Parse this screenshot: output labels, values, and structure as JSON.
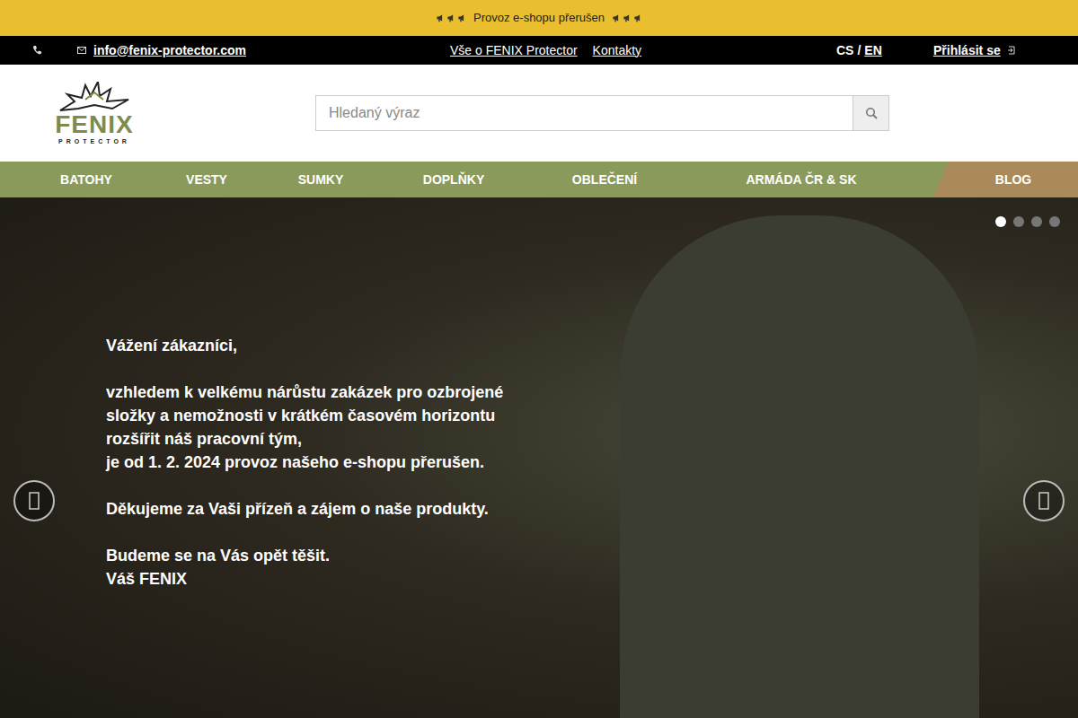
{
  "banner": {
    "text": "Provoz e-shopu přerušen"
  },
  "topbar": {
    "email": "info@fenix-protector.com",
    "links": [
      "Vše o FENIX Protector",
      "Kontakty"
    ],
    "languages": [
      {
        "label": "CS",
        "selected": true
      },
      {
        "label": "EN",
        "selected": false
      }
    ],
    "separator": "/",
    "login": "Přihlásit se"
  },
  "logo": {
    "name": "FENIX",
    "subtitle": "PROTECTOR"
  },
  "search": {
    "placeholder": "Hledaný výraz"
  },
  "nav": [
    {
      "label": "BATOHY",
      "kind": "link"
    },
    {
      "label": "VESTY",
      "kind": "link"
    },
    {
      "label": "SUMKY",
      "kind": "link"
    },
    {
      "label": "DOPLŇKY",
      "kind": "link"
    },
    {
      "label": "OBLEČENÍ",
      "kind": "link"
    },
    {
      "label": "ARMÁDA ČR & SK",
      "kind": "link"
    },
    {
      "label": "BLOG",
      "kind": "highlight"
    }
  ],
  "slider": {
    "paragraphs": [
      [
        "Vážení zákazníci,"
      ],
      [
        "vzhledem k velkému nárůstu zakázek pro ozbrojené",
        "složky a nemožnosti v krátkém časovém horizontu",
        "rozšířit náš pracovní tým,",
        "je od 1. 2. 2024 provoz našeho e-shopu přerušen."
      ],
      [
        "Děkujeme za Vaši přízeň a zájem o naše produkty."
      ],
      [
        "Budeme se na Vás opět těšit.",
        "Váš FENIX"
      ]
    ],
    "dots": [
      {
        "selected": true
      },
      {
        "selected": false
      },
      {
        "selected": false
      },
      {
        "selected": false
      }
    ]
  }
}
